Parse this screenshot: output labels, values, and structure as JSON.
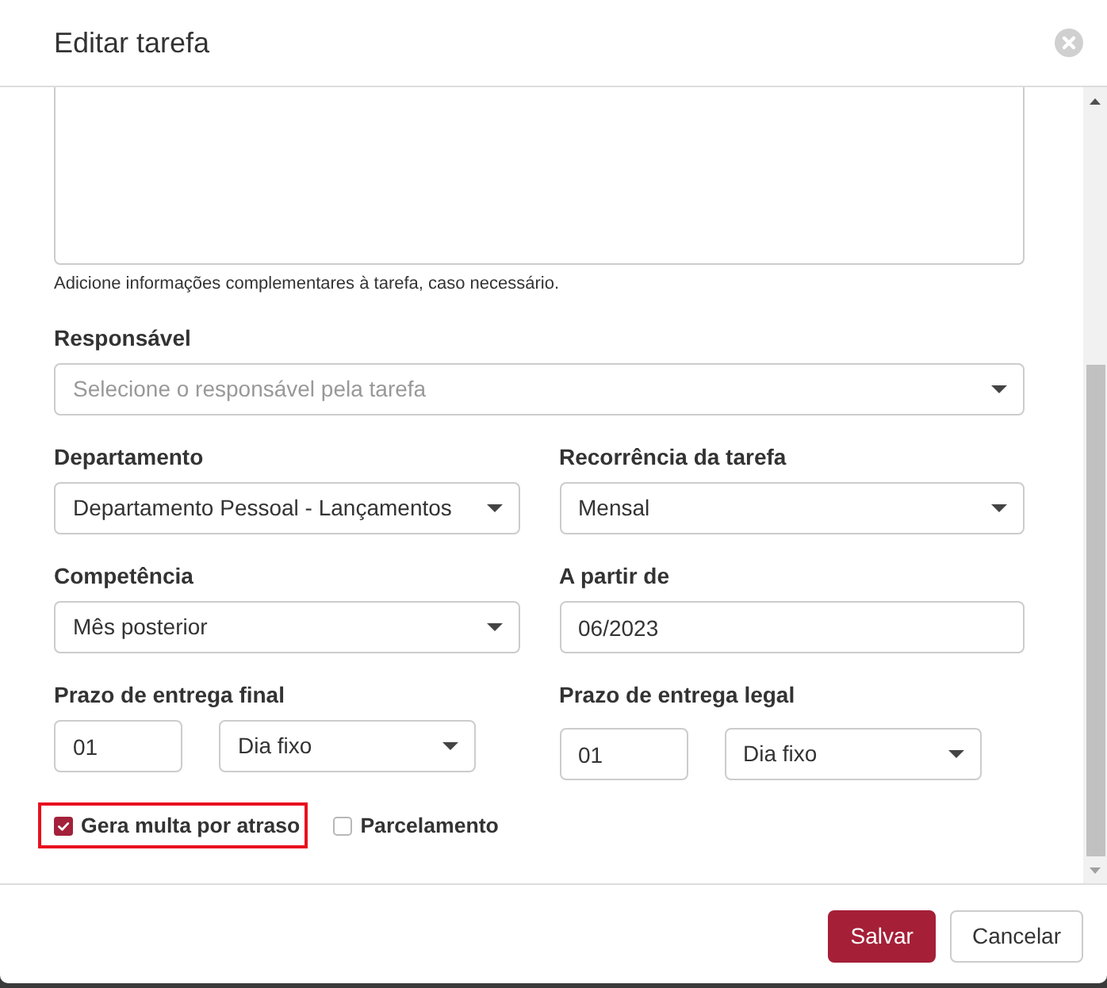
{
  "window": {
    "title": "Editar tarefa"
  },
  "notes_field": {
    "help_text": "Adicione informações complementares à tarefa, caso necessário."
  },
  "form_rows": [
    {
      "fields": [
        {
          "kind": "select",
          "label": "Responsável",
          "placeholder": "Selecione o responsável pela tarefa"
        }
      ]
    },
    {
      "fields": [
        {
          "kind": "select",
          "label": "Departamento",
          "value": "Departamento Pessoal - Lançamentos"
        },
        {
          "kind": "select",
          "label": "Recorrência da tarefa",
          "value": "Mensal"
        }
      ]
    },
    {
      "fields": [
        {
          "kind": "select",
          "label": "Competência",
          "value": "Mês posterior"
        },
        {
          "kind": "input",
          "label": "A partir de",
          "value": "06/2023"
        }
      ]
    },
    {
      "fields": [
        {
          "kind": "deadline",
          "label": "Prazo de entrega final",
          "day": "01",
          "day_type": "Dia fixo"
        },
        {
          "kind": "deadline",
          "label": "Prazo de entrega legal",
          "day": "01",
          "day_type": "Dia fixo"
        }
      ]
    }
  ],
  "checkboxes": [
    {
      "label": "Gera multa por atraso",
      "checked": true,
      "highlighted": true
    },
    {
      "label": "Parcelamento",
      "checked": false,
      "highlighted": false
    }
  ],
  "buttons": [
    {
      "label": "Salvar",
      "kind": "primary"
    },
    {
      "label": "Cancelar",
      "kind": "secondary"
    }
  ]
}
